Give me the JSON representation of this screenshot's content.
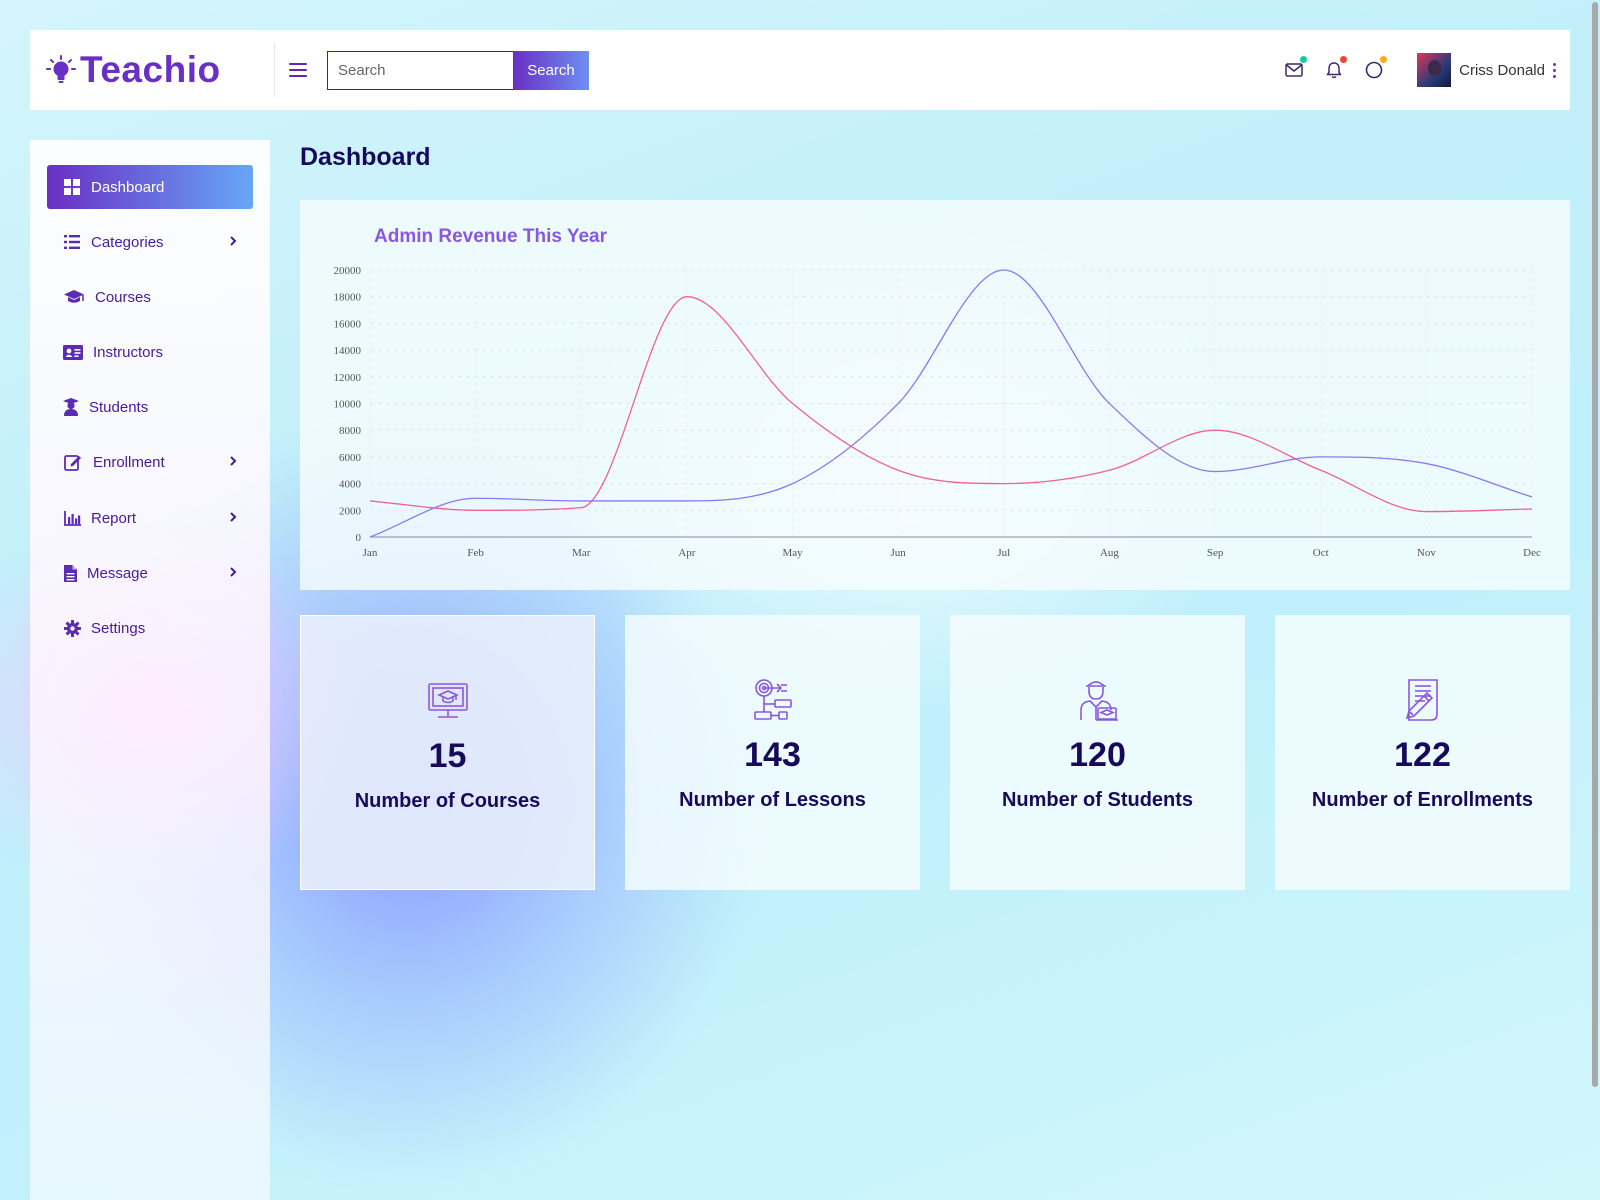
{
  "app": {
    "name": "Teachio"
  },
  "header": {
    "search_placeholder": "Search",
    "search_button": "Search",
    "user_name": "Criss Donald"
  },
  "sidebar": {
    "items": [
      {
        "label": "Dashboard",
        "icon": "grid-icon",
        "active": true,
        "has_submenu": false
      },
      {
        "label": "Categories",
        "icon": "list-icon",
        "active": false,
        "has_submenu": true
      },
      {
        "label": "Courses",
        "icon": "graduation-cap-icon",
        "active": false,
        "has_submenu": false
      },
      {
        "label": "Instructors",
        "icon": "id-card-icon",
        "active": false,
        "has_submenu": false
      },
      {
        "label": "Students",
        "icon": "user-graduate-icon",
        "active": false,
        "has_submenu": false
      },
      {
        "label": "Enrollment",
        "icon": "edit-icon",
        "active": false,
        "has_submenu": true
      },
      {
        "label": "Report",
        "icon": "bar-chart-icon",
        "active": false,
        "has_submenu": true
      },
      {
        "label": "Message",
        "icon": "file-icon",
        "active": false,
        "has_submenu": true
      },
      {
        "label": "Settings",
        "icon": "gear-icon",
        "active": false,
        "has_submenu": false
      }
    ]
  },
  "main": {
    "title": "Dashboard",
    "stats": [
      {
        "value": "15",
        "label": "Number of Courses",
        "icon": "monitor-graduation-icon"
      },
      {
        "value": "143",
        "label": "Number of Lessons",
        "icon": "target-flow-icon"
      },
      {
        "value": "120",
        "label": "Number of Students",
        "icon": "student-laptop-icon"
      },
      {
        "value": "122",
        "label": "Number of Enrollments",
        "icon": "document-pencil-icon"
      }
    ]
  },
  "colors": {
    "brand": "#6a2fc4",
    "accent_blue": "#66a6f6",
    "series_pink": "#f06292",
    "series_purple": "#8c78f0",
    "notify_mail": "#1ec6a0",
    "notify_bell": "#f44336",
    "notify_status": "#ffa726"
  },
  "chart_data": {
    "type": "line",
    "title": "Admin Revenue This Year",
    "categories": [
      "Jan",
      "Feb",
      "Mar",
      "Apr",
      "May",
      "Jun",
      "Jul",
      "Aug",
      "Sep",
      "Oct",
      "Nov",
      "Dec"
    ],
    "yticks": [
      0,
      2000,
      4000,
      6000,
      8000,
      10000,
      12000,
      14000,
      16000,
      18000,
      20000
    ],
    "ylim": [
      0,
      20000
    ],
    "grid": true,
    "smooth": true,
    "series": [
      {
        "color": "#f06292",
        "values": [
          2700,
          2000,
          2200,
          18000,
          10000,
          5000,
          4000,
          5000,
          8000,
          5000,
          1900,
          2100
        ]
      },
      {
        "color": "#8c78f0",
        "values": [
          0,
          2900,
          2700,
          2700,
          4000,
          10000,
          20000,
          10000,
          4900,
          6000,
          5500,
          3000
        ]
      }
    ]
  }
}
